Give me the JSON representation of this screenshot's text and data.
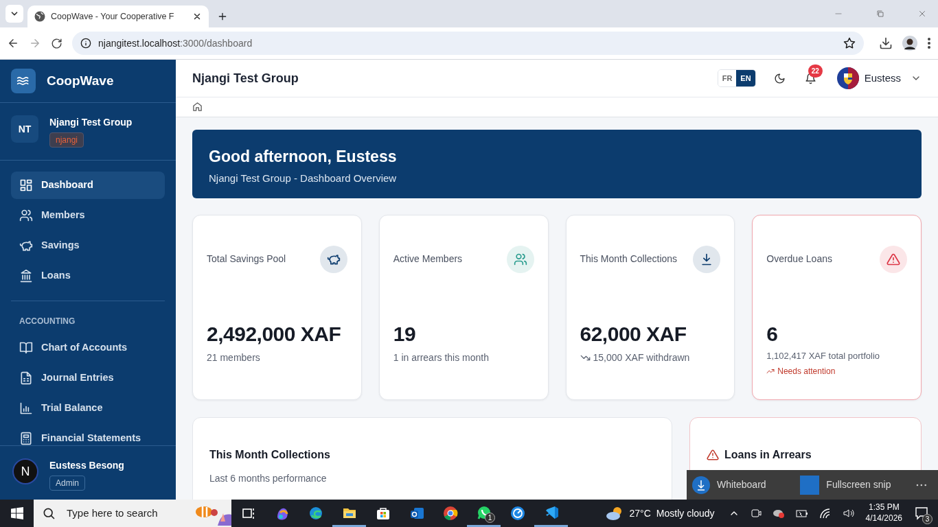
{
  "browser": {
    "tabs": [
      {
        "title": "CoopWave - Your Cooperative F",
        "selected": true
      }
    ],
    "url_host": "njangitest.localhost",
    "url_path": ":3000/dashboard"
  },
  "sidebar": {
    "brand": "CoopWave",
    "group": {
      "initials": "NT",
      "name": "Njangi Test Group",
      "badge": "njangi"
    },
    "nav": [
      {
        "label": "Dashboard",
        "selected": true
      },
      {
        "label": "Members",
        "selected": false
      },
      {
        "label": "Savings",
        "selected": false
      },
      {
        "label": "Loans",
        "selected": false
      }
    ],
    "section_label": "ACCOUNTING",
    "accounting": [
      {
        "label": "Chart of Accounts",
        "selected": false
      },
      {
        "label": "Journal Entries",
        "selected": false
      },
      {
        "label": "Trial Balance",
        "selected": false
      },
      {
        "label": "Financial Statements",
        "selected": false
      }
    ],
    "user": {
      "initial": "N",
      "name": "Eustess Besong",
      "role": "Admin"
    }
  },
  "header": {
    "title": "Njangi Test Group",
    "languages": [
      {
        "label": "FR",
        "selected": false
      },
      {
        "label": "EN",
        "selected": true
      }
    ],
    "notifications": "22",
    "user_name": "Eustess"
  },
  "banner": {
    "greeting": "Good afternoon, Eustess",
    "subtitle": "Njangi Test Group - Dashboard Overview"
  },
  "stats": [
    {
      "label": "Total Savings Pool",
      "value": "2,492,000 XAF",
      "color": "#0c3c6e",
      "alert": false,
      "notes": [
        {
          "text": "21 members",
          "kind": "plain"
        }
      ]
    },
    {
      "label": "Active Members",
      "value": "19",
      "color": "#2a9d8f",
      "alert": false,
      "notes": [
        {
          "text": "1 in arrears this month",
          "kind": "plain"
        }
      ]
    },
    {
      "label": "This Month Collections",
      "value": "62,000 XAF",
      "color": "#0c3c6e",
      "alert": false,
      "notes": [
        {
          "text": "15,000 XAF withdrawn",
          "kind": "down"
        }
      ]
    },
    {
      "label": "Overdue Loans",
      "value": "6",
      "color": "#dc3545",
      "alert": true,
      "notes": [
        {
          "text": "1,102,417 XAF total portfolio",
          "kind": "small"
        },
        {
          "text": "Needs attention",
          "kind": "up"
        }
      ]
    }
  ],
  "panels": {
    "collections": {
      "title": "This Month Collections",
      "subtitle": "Last 6 months performance"
    },
    "arrears": {
      "title": "Loans in Arrears"
    }
  },
  "snip_toolbar": [
    {
      "label": "Whiteboard"
    },
    {
      "label": "Fullscreen snip"
    }
  ],
  "taskbar": {
    "search_placeholder": "Type here to search",
    "whatsapp_badge": "1",
    "weather_temp": "27°C",
    "weather_text": "Mostly cloudy",
    "time": "1:35 PM",
    "date": "4/14/2026",
    "notification_count": "3"
  }
}
